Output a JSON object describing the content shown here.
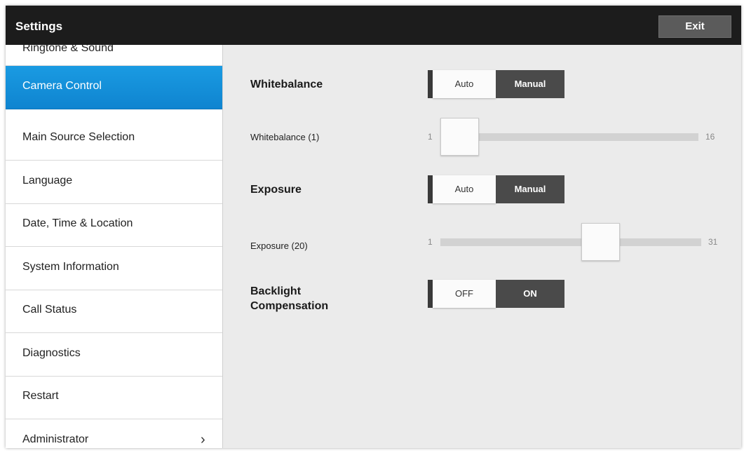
{
  "app": {
    "title": "Settings",
    "exit_label": "Exit"
  },
  "sidebar": {
    "items": [
      {
        "label": "Ringtone & Sound",
        "active": false
      },
      {
        "label": "Camera Control",
        "active": true
      },
      {
        "label": "Main Source Selection",
        "active": false
      },
      {
        "label": "Language",
        "active": false
      },
      {
        "label": "Date, Time & Location",
        "active": false
      },
      {
        "label": "System Information",
        "active": false
      },
      {
        "label": "Call Status",
        "active": false
      },
      {
        "label": "Diagnostics",
        "active": false
      },
      {
        "label": "Restart",
        "active": false
      },
      {
        "label": "Administrator",
        "active": false,
        "has_submenu": true,
        "chevron_icon": "chevron-right-icon",
        "chevron_glyph": "›"
      }
    ]
  },
  "camera": {
    "whitebalance": {
      "title": "Whitebalance",
      "options": [
        "Auto",
        "Manual"
      ],
      "selected": "Manual",
      "slider": {
        "label": "Whitebalance (1)",
        "min": 1,
        "max": 16,
        "value": 1,
        "min_label": "1",
        "max_label": "16"
      }
    },
    "exposure": {
      "title": "Exposure",
      "options": [
        "Auto",
        "Manual"
      ],
      "selected": "Manual",
      "slider": {
        "label": "Exposure (20)",
        "min": 1,
        "max": 31,
        "value": 20,
        "min_label": "1",
        "max_label": "31"
      }
    },
    "backlight": {
      "title_line1": "Backlight",
      "title_line2": "Compensation",
      "options": [
        "OFF",
        "ON"
      ],
      "selected": "ON"
    }
  },
  "colors": {
    "topbar": "#1c1c1c",
    "active_item": "#1590d8",
    "toggle_selected": "#4a4a4a",
    "slider_track": "#d2d2d2"
  }
}
